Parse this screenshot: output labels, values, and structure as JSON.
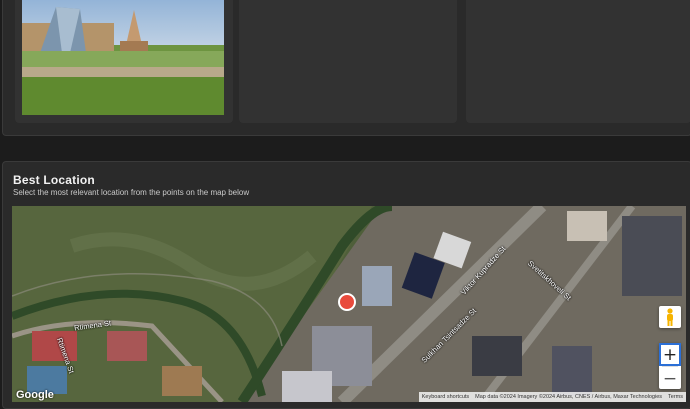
{
  "location_section": {
    "title": "Best Location",
    "subtitle": "Select the most relevant location from the points on the map below"
  },
  "map": {
    "street_labels": [
      "Rtimena St",
      "Viktor Kupradze St",
      "Svetitskhoveli St",
      "Sulkhan Tsintsadze St",
      "Rtimena St"
    ],
    "logo": "Google",
    "attribution": {
      "shortcuts": "Keyboard shortcuts",
      "data": "Map data ©2024 Imagery ©2024 Airbus, CNES / Airbus, Maxar Technologies",
      "terms": "Terms"
    },
    "zoom_in_label": "+",
    "zoom_out_label": "−",
    "marker_color": "#e84a3c"
  },
  "icons": [
    "pegman-icon",
    "map-marker-icon"
  ]
}
